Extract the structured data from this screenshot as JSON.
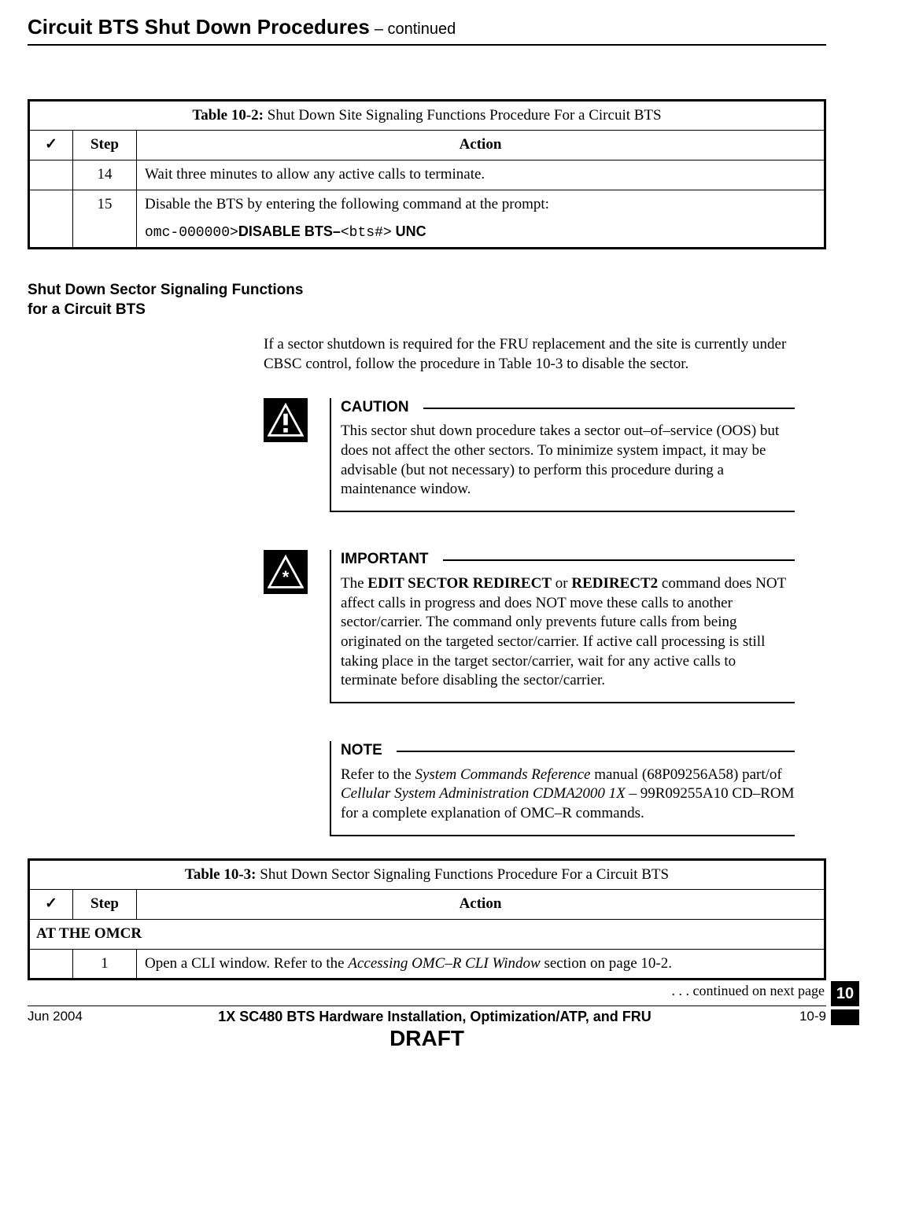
{
  "header": {
    "title": "Circuit BTS Shut Down Procedures",
    "cont": "  – continued"
  },
  "table2": {
    "title_label": "Table 10-2:",
    "title_rest": " Shut Down Site Signaling Functions Procedure For a Circuit BTS",
    "check_hdr": "✓",
    "step_hdr": "Step",
    "action_hdr": "Action",
    "rows": [
      {
        "step": "14",
        "action": "Wait three minutes to allow any active calls to terminate."
      },
      {
        "step": "15",
        "action_line1": "Disable the BTS by entering the following command at the prompt:",
        "cmd_prompt": "omc-000000>",
        "cmd_bold": "DISABLE BTS–",
        "cmd_var": "<bts#>",
        "cmd_end": " UNC"
      }
    ]
  },
  "section2": {
    "head1": "Shut Down Sector Signaling Functions",
    "head2": "for a Circuit BTS",
    "intro": "If a sector shutdown is required for the FRU replacement and the site is currently under CBSC control, follow the procedure in Table 10-3 to disable the sector."
  },
  "caution": {
    "title": "CAUTION",
    "text": "This sector shut down procedure takes a sector out–of–service (OOS) but does not affect the other sectors. To minimize system impact, it may be advisable (but not necessary) to perform this procedure during a maintenance window."
  },
  "important": {
    "title": "IMPORTANT",
    "pre": "The ",
    "bold1": "EDIT SECTOR REDIRECT",
    "mid": " or ",
    "bold2": "REDIRECT2",
    "post": " command does NOT affect calls in progress and does NOT move these calls to another sector/carrier. The command only prevents future calls from being originated on the targeted sector/carrier. If active call processing is still taking place in the target sector/carrier, wait for any active calls to terminate before disabling the sector/carrier."
  },
  "note": {
    "title": "NOTE",
    "pre": "Refer to the ",
    "ital1": "System Commands Reference",
    "mid1": " manual (68P09256A58) part/of ",
    "ital2": "Cellular System Administration CDMA2000 1X",
    "post": " – 99R09255A10 CD–ROM for a complete explanation of OMC–R commands."
  },
  "table3": {
    "title_label": "Table 10-3:",
    "title_rest": " Shut Down Sector Signaling Functions Procedure For a Circuit BTS",
    "check_hdr": "✓",
    "step_hdr": "Step",
    "action_hdr": "Action",
    "subhead": "AT THE OMCR",
    "row1_step": "1",
    "row1_pre": "Open a CLI window. Refer to the ",
    "row1_ital": "Accessing OMC–R CLI Window",
    "row1_post": " section on page 10-2."
  },
  "continued": ". . . continued on next page",
  "footer": {
    "left": "Jun 2004",
    "mid": "1X SC480 BTS Hardware Installation, Optimization/ATP, and FRU",
    "right": "10-9",
    "draft": "DRAFT"
  },
  "tab": "10"
}
